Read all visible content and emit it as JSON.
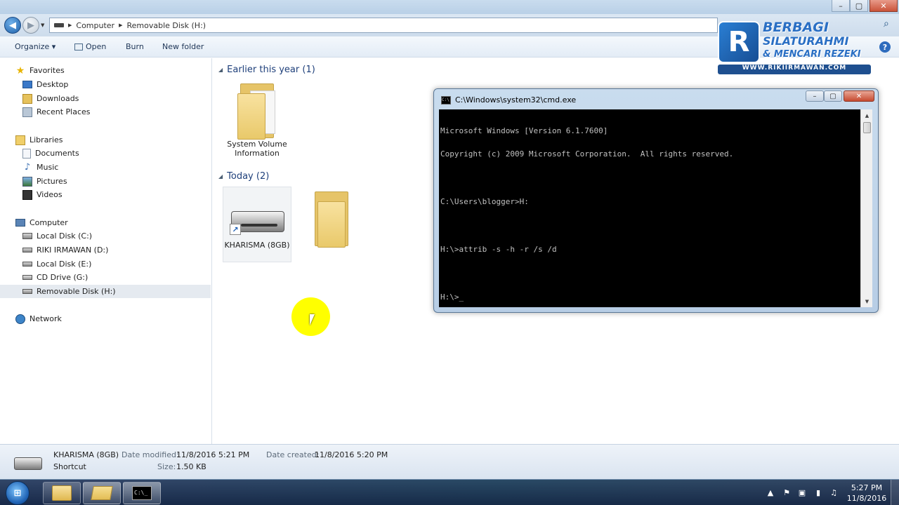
{
  "explorer": {
    "window_controls": {
      "minimize": "–",
      "maximize": "▢",
      "close": "✕"
    },
    "breadcrumb": [
      "Computer",
      "Removable Disk (H:)"
    ],
    "toolbar": {
      "organize": "Organize ▾",
      "open": "Open",
      "burn": "Burn",
      "new_folder": "New folder",
      "help": "?"
    },
    "sidebar": {
      "favorites": "Favorites",
      "desktop": "Desktop",
      "downloads": "Downloads",
      "recent_places": "Recent Places",
      "libraries": "Libraries",
      "documents": "Documents",
      "music": "Music",
      "pictures": "Pictures",
      "videos": "Videos",
      "computer": "Computer",
      "local_c": "Local Disk (C:)",
      "riki_d": "RIKI IRMAWAN (D:)",
      "local_e": "Local Disk (E:)",
      "cd_g": "CD Drive (G:)",
      "removable_h": "Removable Disk (H:)",
      "network": "Network"
    },
    "groups": {
      "earlier": "Earlier this year (1)",
      "today": "Today (2)"
    },
    "files": {
      "svi_line1": "System Volume",
      "svi_line2": "Information",
      "shortcut": "KHARISMA (8GB)"
    },
    "details": {
      "name": "KHARISMA (8GB)",
      "type": "Shortcut",
      "modified_label": "Date modified:",
      "modified_value": "11/8/2016 5:21 PM",
      "size_label": "Size:",
      "size_value": "1.50 KB",
      "created_label": "Date created:",
      "created_value": "11/8/2016 5:20 PM"
    }
  },
  "logo": {
    "mark": "R",
    "line1": "BERBAGI",
    "line2": "SILATURAHMI",
    "line3": "& MENCARI REZEKI",
    "url": "WWW.RIKIIRMAWAN.COM"
  },
  "cmd": {
    "title": "C:\\Windows\\system32\\cmd.exe",
    "lines": [
      "Microsoft Windows [Version 6.1.7600]",
      "Copyright (c) 2009 Microsoft Corporation.  All rights reserved.",
      "",
      "C:\\Users\\blogger>H:",
      "",
      "H:\\>attrib -s -h -r /s /d",
      "",
      "H:\\>_"
    ]
  },
  "taskbar": {
    "clock_time": "5:27 PM",
    "clock_date": "11/8/2016"
  },
  "colors": {
    "accent": "#1e3f7a",
    "cursor_highlight": "#ffff00",
    "cmd_background": "#000000",
    "cmd_text": "#c0c0c0"
  }
}
